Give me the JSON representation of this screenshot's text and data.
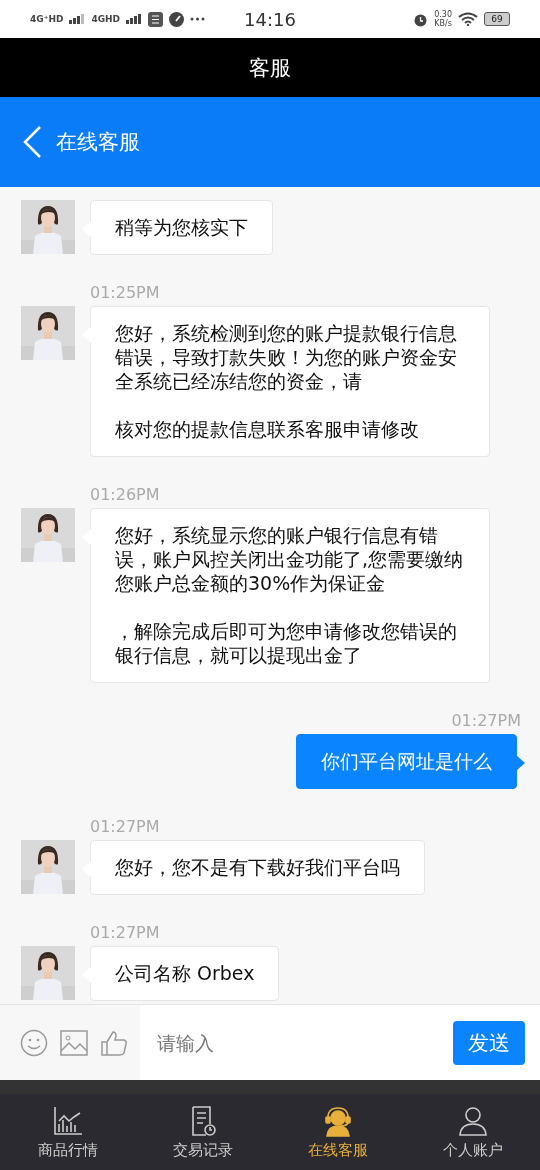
{
  "status_bar": {
    "network_1": "4G⁺HD",
    "network_2": "4GHD",
    "time": "14:16",
    "speed": "0.30",
    "speed_unit": "KB/s",
    "battery": "69"
  },
  "title_bar": {
    "title": "客服"
  },
  "header": {
    "title": "在线客服"
  },
  "messages": [
    {
      "kind": "incoming",
      "paragraphs": [
        "稍等为您核实下"
      ]
    },
    {
      "kind": "incoming",
      "time": "01:25PM",
      "paragraphs": [
        "您好，系统检测到您的账户提款银行信息错误，导致打款失败！为您的账户资金安全系统已经冻结您的资金，请",
        "核对您的提款信息联系客服申请修改"
      ]
    },
    {
      "kind": "incoming",
      "time": "01:26PM",
      "paragraphs": [
        "您好，系统显示您的账户银行信息有错误，账户风控关闭出金功能了,您需要缴纳您账户总金额的30%作为保证金",
        "，解除完成后即可为您申请修改您错误的银行信息，就可以提现出金了"
      ]
    },
    {
      "kind": "outgoing",
      "time": "01:27PM",
      "paragraphs": [
        "你们平台网址是什么"
      ]
    },
    {
      "kind": "incoming",
      "time": "01:27PM",
      "paragraphs": [
        "您好，您不是有下载好我们平台吗"
      ]
    },
    {
      "kind": "incoming",
      "time": "01:27PM",
      "paragraphs": [
        "公司名称 Orbex"
      ]
    }
  ],
  "composer": {
    "placeholder": "请输入",
    "send": "发送"
  },
  "tabs": [
    {
      "label": "商品行情",
      "kind": "chart",
      "selected": false
    },
    {
      "label": "交易记录",
      "kind": "record",
      "selected": false
    },
    {
      "label": "在线客服",
      "kind": "service",
      "selected": true
    },
    {
      "label": "个人账户",
      "kind": "person",
      "selected": false
    }
  ]
}
